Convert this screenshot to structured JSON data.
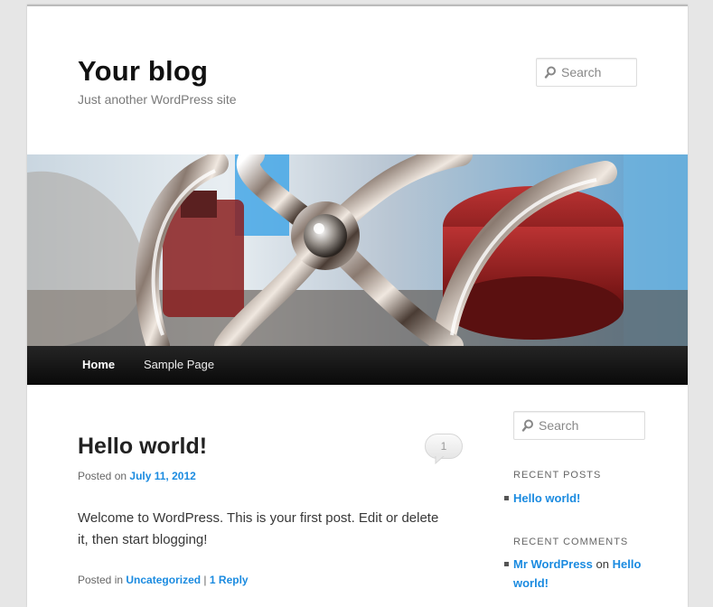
{
  "header": {
    "site_title": "Your blog",
    "site_description": "Just another WordPress site",
    "search": {
      "placeholder": "Search"
    }
  },
  "banner": {
    "alt": "Chrome hand wheel on red machinery"
  },
  "nav": {
    "items": [
      {
        "label": "Home",
        "active": true
      },
      {
        "label": "Sample Page",
        "active": false
      }
    ]
  },
  "post": {
    "title": "Hello world!",
    "comment_count": "1",
    "posted_on_label": "Posted on",
    "date": "July 11, 2012",
    "content": "Welcome to WordPress. This is your first post. Edit or delete it, then start blogging!",
    "posted_in_label": "Posted in",
    "category": "Uncategorized",
    "separator": "|",
    "reply_link": "1 Reply"
  },
  "sidebar": {
    "search": {
      "placeholder": "Search"
    },
    "recent_posts": {
      "title": "RECENT POSTS",
      "items": [
        "Hello world!"
      ]
    },
    "recent_comments": {
      "title": "RECENT COMMENTS",
      "author": "Mr WordPress",
      "on_label": "on",
      "post": "Hello world!"
    }
  },
  "colors": {
    "link": "#1b8be0",
    "nav_bg": "#1a1a1a",
    "page_bg": "#ffffff",
    "body_bg": "#e6e6e6"
  }
}
